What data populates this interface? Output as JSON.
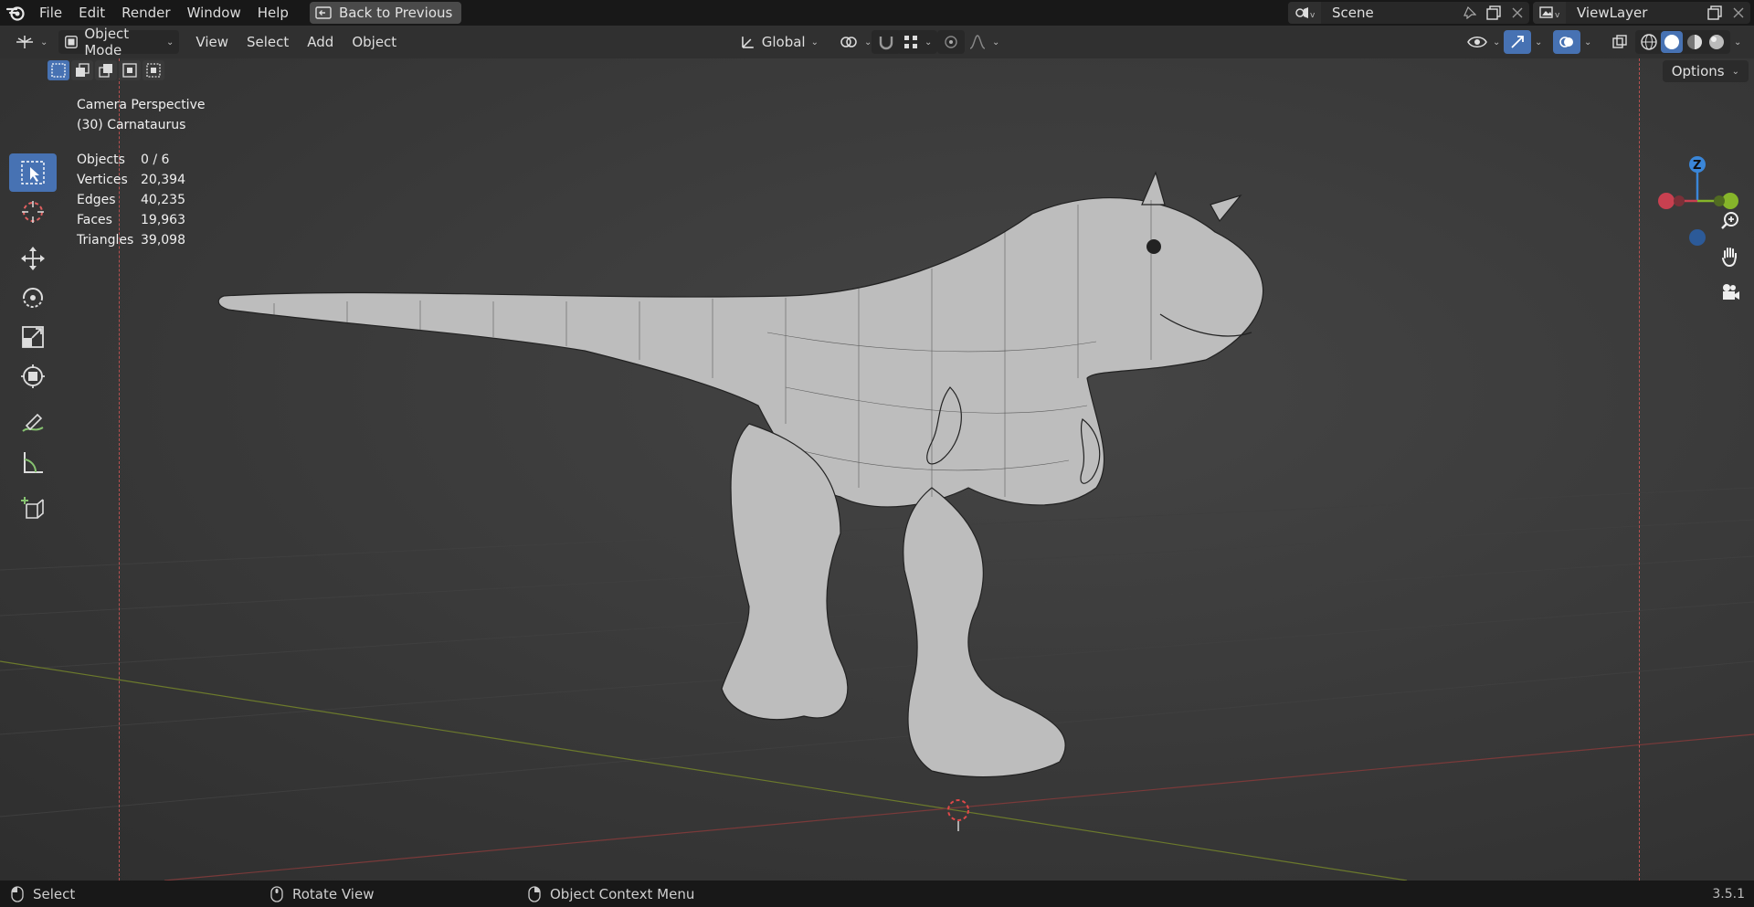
{
  "app_menu": {
    "items": [
      "File",
      "Edit",
      "Render",
      "Window",
      "Help"
    ],
    "back_button": "Back to Previous"
  },
  "scene": {
    "name": "Scene",
    "view_layer": "ViewLayer"
  },
  "header": {
    "mode": "Object Mode",
    "menus": [
      "View",
      "Select",
      "Add",
      "Object"
    ],
    "transform_orientation": "Global"
  },
  "sub_header": {
    "options_label": "Options"
  },
  "viewport": {
    "view_name": "Camera Perspective",
    "object_name": "(30) Carnataurus",
    "stats": [
      {
        "label": "Objects",
        "value": "0 / 6"
      },
      {
        "label": "Vertices",
        "value": "20,394"
      },
      {
        "label": "Edges",
        "value": "40,235"
      },
      {
        "label": "Faces",
        "value": "19,963"
      },
      {
        "label": "Triangles",
        "value": "39,098"
      }
    ],
    "gizmo_axis_label": "Z"
  },
  "statusbar": {
    "select": "Select",
    "rotate": "Rotate View",
    "context_menu": "Object Context Menu",
    "version": "3.5.1"
  },
  "colors": {
    "accent": "#4772b3",
    "axis_x": "#e24b5b",
    "axis_y": "#86b52a",
    "axis_z": "#3a86d8"
  },
  "icons": [
    "blender-logo",
    "back-icon",
    "scene-icon",
    "pin-icon",
    "copy-icon",
    "close-icon",
    "view-layer-icon",
    "editor-type-icon",
    "object-mode-icon",
    "transform-orientation-icon",
    "pivot-icon",
    "snap-icon",
    "proportional-edit-icon",
    "visibility-icon",
    "gizmo-icon",
    "overlay-icon",
    "xray-icon",
    "wireframe-shading-icon",
    "solid-shading-icon",
    "material-shading-icon",
    "rendered-shading-icon",
    "select-box-icon",
    "cursor-icon",
    "move-icon",
    "rotate-icon",
    "scale-icon",
    "transform-icon",
    "annotate-icon",
    "measure-icon",
    "add-cube-icon",
    "zoom-icon",
    "hand-icon",
    "camera-icon",
    "mouse-icon"
  ]
}
